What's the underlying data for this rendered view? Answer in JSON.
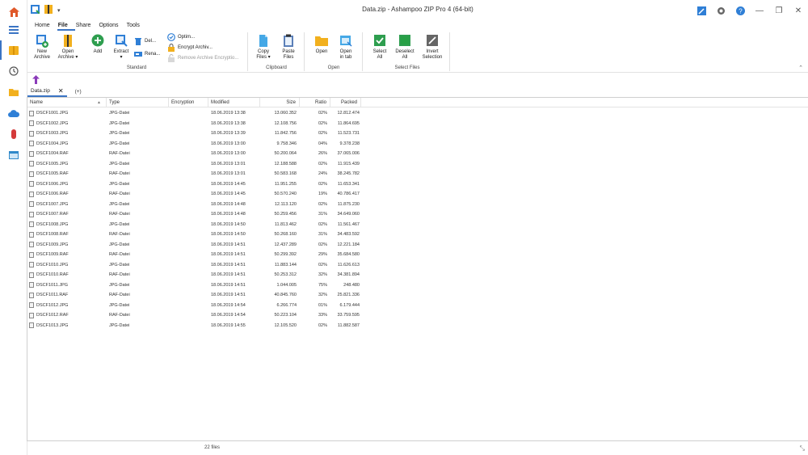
{
  "window": {
    "title": "Data.zip - Ashampoo ZIP Pro 4 (64-bit)",
    "minimize": "—",
    "maximize": "❐",
    "close": "✕"
  },
  "ribbon_tabs": [
    {
      "label": "Home",
      "active": false
    },
    {
      "label": "File",
      "active": true
    },
    {
      "label": "Share",
      "active": false
    },
    {
      "label": "Options",
      "active": false
    },
    {
      "label": "Tools",
      "active": false
    }
  ],
  "ribbon": {
    "standard": {
      "new_archive": "New\nArchive",
      "open_archive": "Open\nArchive ▾",
      "add": "Add",
      "extract": "Extract\n▾",
      "delete": "Del...",
      "rename": "Rena...",
      "optimize": "Optim...",
      "encrypt": "Encrypt Archiv...",
      "remove_encryption": "Remove Archive Encryptio...",
      "group_label": "Standard"
    },
    "clipboard": {
      "copy_files": "Copy\nFiles ▾",
      "paste_files": "Paste\nFiles",
      "group_label": "Clipboard"
    },
    "open": {
      "open": "Open",
      "open_in_tab": "Open\nin tab",
      "group_label": "Open"
    },
    "select": {
      "select_all": "Select\nAll",
      "deselect_all": "Deselect\nAll",
      "invert": "Invert\nSelection",
      "group_label": "Select Files"
    }
  },
  "doc_tab": {
    "label": "Data.zip",
    "close": "✕",
    "add": "(+)"
  },
  "columns": {
    "name": "Name",
    "type": "Type",
    "encryption": "Encryption",
    "modified": "Modified",
    "size": "Size",
    "ratio": "Ratio",
    "packed": "Packed"
  },
  "files": [
    {
      "name": "DSCF1001.JPG",
      "type": "JPG-Datei",
      "encryption": "",
      "modified": "18.06.2019 13:38",
      "size": "13.060.352",
      "ratio": "02%",
      "packed": "12.812.474"
    },
    {
      "name": "DSCF1002.JPG",
      "type": "JPG-Datei",
      "encryption": "",
      "modified": "18.06.2019 13:38",
      "size": "12.108.756",
      "ratio": "02%",
      "packed": "11.864.695"
    },
    {
      "name": "DSCF1003.JPG",
      "type": "JPG-Datei",
      "encryption": "",
      "modified": "18.06.2019 13:39",
      "size": "11.842.756",
      "ratio": "02%",
      "packed": "11.523.731"
    },
    {
      "name": "DSCF1004.JPG",
      "type": "JPG-Datei",
      "encryption": "",
      "modified": "18.06.2019 13:00",
      "size": "9.758.346",
      "ratio": "04%",
      "packed": "9.378.238"
    },
    {
      "name": "DSCF1004.RAF",
      "type": "RAF-Datei",
      "encryption": "",
      "modified": "18.06.2019 13:00",
      "size": "50.200.064",
      "ratio": "26%",
      "packed": "37.065.006"
    },
    {
      "name": "DSCF1005.JPG",
      "type": "JPG-Datei",
      "encryption": "",
      "modified": "18.06.2019 13:01",
      "size": "12.188.588",
      "ratio": "02%",
      "packed": "11.915.439"
    },
    {
      "name": "DSCF1005.RAF",
      "type": "RAF-Datei",
      "encryption": "",
      "modified": "18.06.2019 13:01",
      "size": "50.583.168",
      "ratio": "24%",
      "packed": "38.245.782"
    },
    {
      "name": "DSCF1006.JPG",
      "type": "JPG-Datei",
      "encryption": "",
      "modified": "18.06.2019 14:45",
      "size": "11.951.255",
      "ratio": "02%",
      "packed": "11.653.341"
    },
    {
      "name": "DSCF1006.RAF",
      "type": "RAF-Datei",
      "encryption": "",
      "modified": "18.06.2019 14:45",
      "size": "50.570.240",
      "ratio": "19%",
      "packed": "40.786.417"
    },
    {
      "name": "DSCF1007.JPG",
      "type": "JPG-Datei",
      "encryption": "",
      "modified": "18.06.2019 14:48",
      "size": "12.113.120",
      "ratio": "02%",
      "packed": "11.875.230"
    },
    {
      "name": "DSCF1007.RAF",
      "type": "RAF-Datei",
      "encryption": "",
      "modified": "18.06.2019 14:48",
      "size": "50.259.456",
      "ratio": "31%",
      "packed": "34.649.060"
    },
    {
      "name": "DSCF1008.JPG",
      "type": "JPG-Datei",
      "encryption": "",
      "modified": "18.06.2019 14:50",
      "size": "11.813.462",
      "ratio": "02%",
      "packed": "11.561.467"
    },
    {
      "name": "DSCF1008.RAF",
      "type": "RAF-Datei",
      "encryption": "",
      "modified": "18.06.2019 14:50",
      "size": "50.268.160",
      "ratio": "31%",
      "packed": "34.483.592"
    },
    {
      "name": "DSCF1009.JPG",
      "type": "JPG-Datei",
      "encryption": "",
      "modified": "18.06.2019 14:51",
      "size": "12.437.289",
      "ratio": "02%",
      "packed": "12.221.184"
    },
    {
      "name": "DSCF1009.RAF",
      "type": "RAF-Datei",
      "encryption": "",
      "modified": "18.06.2019 14:51",
      "size": "50.299.392",
      "ratio": "29%",
      "packed": "35.684.580"
    },
    {
      "name": "DSCF1010.JPG",
      "type": "JPG-Datei",
      "encryption": "",
      "modified": "18.06.2019 14:51",
      "size": "11.883.144",
      "ratio": "02%",
      "packed": "11.626.613"
    },
    {
      "name": "DSCF1010.RAF",
      "type": "RAF-Datei",
      "encryption": "",
      "modified": "18.06.2019 14:51",
      "size": "50.253.312",
      "ratio": "32%",
      "packed": "34.381.894"
    },
    {
      "name": "DSCF1011.JPG",
      "type": "JPG-Datei",
      "encryption": "",
      "modified": "18.06.2019 14:51",
      "size": "1.044.005",
      "ratio": "75%",
      "packed": "248.480"
    },
    {
      "name": "DSCF1011.RAF",
      "type": "RAF-Datei",
      "encryption": "",
      "modified": "18.06.2019 14:51",
      "size": "40.845.760",
      "ratio": "32%",
      "packed": "25.821.336"
    },
    {
      "name": "DSCF1012.JPG",
      "type": "JPG-Datei",
      "encryption": "",
      "modified": "18.06.2019 14:54",
      "size": "6.266.774",
      "ratio": "01%",
      "packed": "6.179.444"
    },
    {
      "name": "DSCF1012.RAF",
      "type": "RAF-Datei",
      "encryption": "",
      "modified": "18.06.2019 14:54",
      "size": "50.223.104",
      "ratio": "33%",
      "packed": "33.759.595"
    },
    {
      "name": "DSCF1013.JPG",
      "type": "JPG-Datei",
      "encryption": "",
      "modified": "18.06.2019 14:55",
      "size": "12.105.520",
      "ratio": "02%",
      "packed": "11.882.587"
    }
  ],
  "status": {
    "file_count": "22 files"
  },
  "colors": {
    "accent": "#3a74c4",
    "green": "#2e9e4f",
    "yellow": "#f2b01e"
  }
}
